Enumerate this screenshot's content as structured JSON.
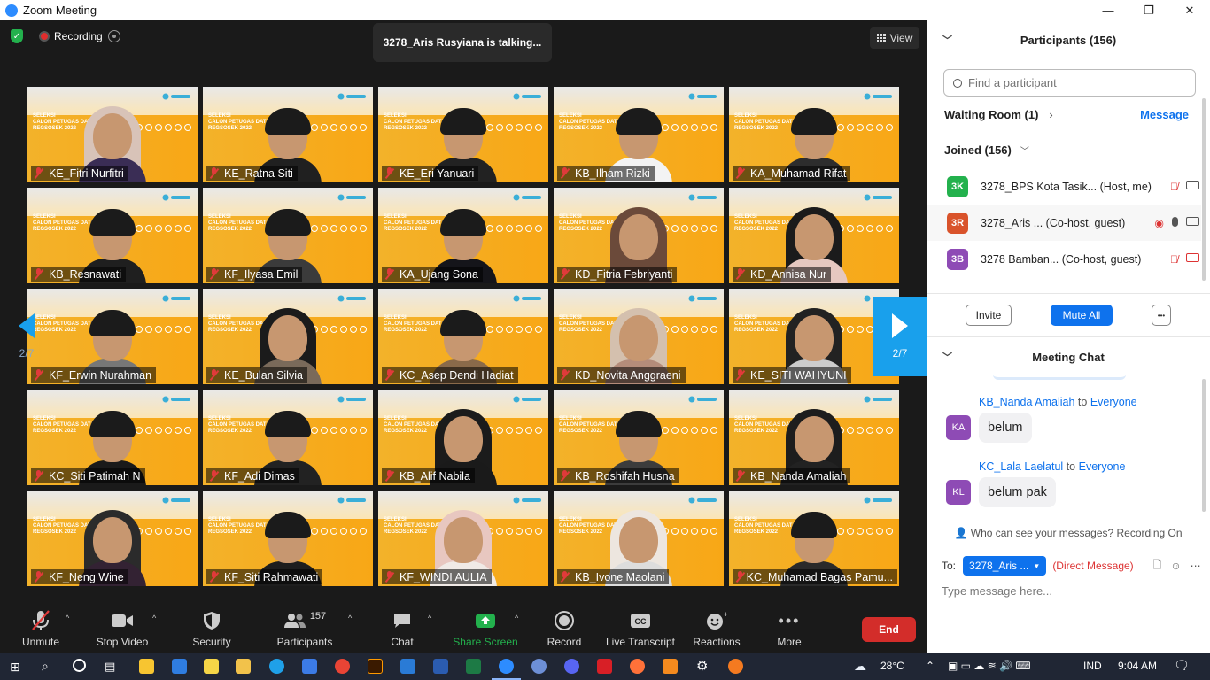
{
  "window": {
    "title": "Zoom Meeting",
    "minimize": "—",
    "maximize": "❐",
    "close": "✕"
  },
  "top": {
    "recording_label": "Recording",
    "talking_banner": "3278_Aris Rusyiana is talking...",
    "view_label": "View"
  },
  "pager": {
    "left": "2/7",
    "right": "2/7"
  },
  "tiles": [
    {
      "name": "KE_Fitri Nurfitri"
    },
    {
      "name": "KE_Ratna Siti"
    },
    {
      "name": "KE_Eri Yanuari"
    },
    {
      "name": "KB_Ilham Rizki"
    },
    {
      "name": "KA_Muhamad Rifat"
    },
    {
      "name": "KB_Resnawati"
    },
    {
      "name": "KF_Ilyasa Emil"
    },
    {
      "name": "KA_Ujang Sona"
    },
    {
      "name": "KD_Fitria Febriyanti"
    },
    {
      "name": "KD_Annisa Nur"
    },
    {
      "name": "KF_Erwin Nurahman"
    },
    {
      "name": "KE_Bulan Silvia"
    },
    {
      "name": "KC_Asep Dendi Hadiat"
    },
    {
      "name": "KD_Novita Anggraeni"
    },
    {
      "name": "KE_SITI WAHYUNI"
    },
    {
      "name": "KC_Siti Patimah N"
    },
    {
      "name": "KF_Adi Dimas"
    },
    {
      "name": "KB_Alif Nabila"
    },
    {
      "name": "KB_Roshifah Husna"
    },
    {
      "name": "KB_Nanda Amaliah"
    },
    {
      "name": "KF_Neng Wine"
    },
    {
      "name": "KF_Siti Rahmawati"
    },
    {
      "name": "KF_WINDI AULIA"
    },
    {
      "name": "KB_Ivone Maolani"
    },
    {
      "name": "KC_Muhamad Bagas Pamu..."
    }
  ],
  "toolbar": {
    "unmute": "Unmute",
    "stop_video": "Stop Video",
    "security": "Security",
    "participants": "Participants",
    "participants_count": "157",
    "chat": "Chat",
    "share_screen": "Share Screen",
    "record": "Record",
    "live_transcript": "Live Transcript",
    "reactions": "Reactions",
    "more": "More",
    "end": "End"
  },
  "participants_panel": {
    "title": "Participants (156)",
    "search_placeholder": "Find a participant",
    "waiting_room": "Waiting Room (1)",
    "message": "Message",
    "joined": "Joined (156)",
    "rows": [
      {
        "initials": "3K",
        "color": "#23b14d",
        "name": "3278_BPS Kota Tasik...",
        "role": "(Host, me)"
      },
      {
        "initials": "3R",
        "color": "#d9532b",
        "name": "3278_Aris ...",
        "role": "(Co-host, guest)"
      },
      {
        "initials": "3B",
        "color": "#8e4bb5",
        "name": "3278 Bamban...",
        "role": "(Co-host, guest)"
      }
    ],
    "invite": "Invite",
    "mute_all": "Mute All",
    "more": "•••"
  },
  "chat": {
    "title": "Meeting Chat",
    "messages": [
      {
        "initials": "KA",
        "from": "KB_Nanda Amaliah",
        "to_word": "to",
        "to": "Everyone",
        "text": "belum"
      },
      {
        "initials": "KL",
        "from": "KC_Lala Laelatul",
        "to_word": "to",
        "to": "Everyone",
        "text": "belum pak"
      }
    ],
    "who_can_see": "Who can see your messages? Recording On",
    "to_label": "To:",
    "to_value": "3278_Aris ...",
    "direct": "(Direct Message)",
    "placeholder": "Type message here..."
  },
  "taskbar": {
    "temperature": "28°C",
    "lang": "IND",
    "time": "9:04 AM"
  },
  "colors": {
    "accent": "#0e72ed",
    "end": "#d32d2a",
    "share": "#23b14d",
    "nav": "#19a0ec"
  }
}
